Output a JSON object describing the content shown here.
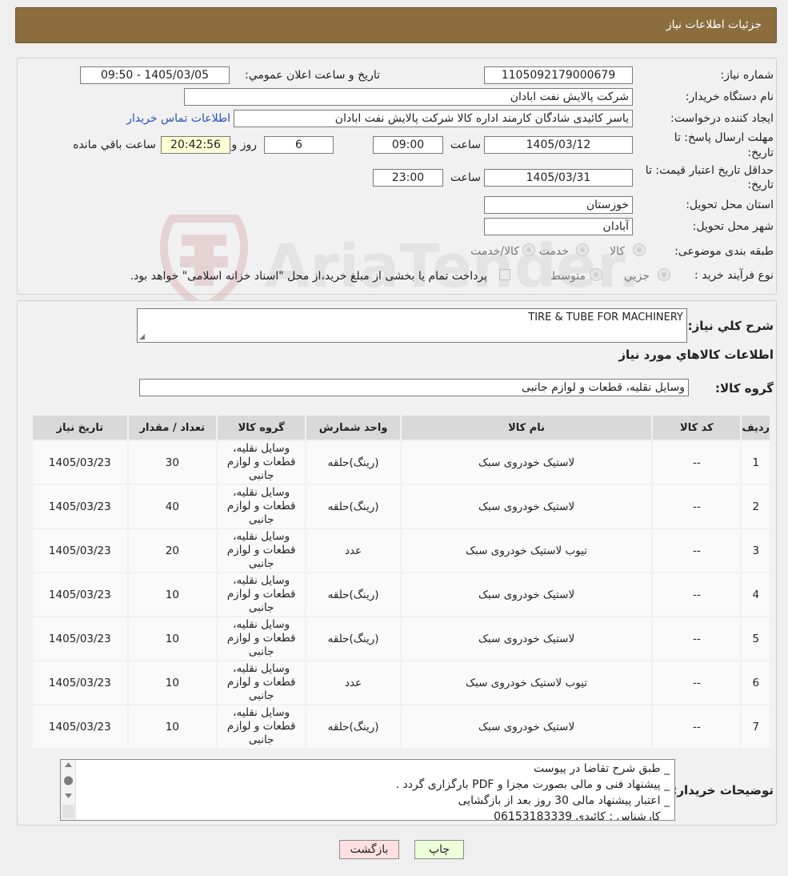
{
  "header": {
    "title": "جزئیات اطلاعات نیاز"
  },
  "form": {
    "need_number_label": "شماره نیاز:",
    "need_number": "1105092179000679",
    "announce_label": "تاريخ و ساعت اعلان عمومي:",
    "announce_value": "1405/03/05 - 09:50",
    "buyer_label": "نام دستگاه خریدار:",
    "buyer_value": "شرکت پالایش نفت ابادان",
    "creator_label": "ایجاد کننده درخواست:",
    "creator_value": "یاسر کائیدی شادگان کارمند اداره کالا شرکت پالایش نفت ابادان",
    "contact_link": "اطلاعات تماس خریدار",
    "deadline_label_1": "مهلت ارسال پاسخ: تا",
    "deadline_label_2": "تاریخ:",
    "deadline_date": "1405/03/12",
    "hour_label": "ساعت",
    "deadline_time": "09:00",
    "days_value": "6",
    "days_label": "روز و",
    "remaining_time": "20:42:56",
    "remaining_label": "ساعت باقي مانده",
    "validity_label_1": "حداقل تاریخ اعتبار قیمت: تا",
    "validity_label_2": "تاریخ:",
    "validity_date": "1405/03/31",
    "validity_time": "23:00",
    "province_label": "استان محل تحویل:",
    "province_value": "خوزستان",
    "city_label": "شهر محل تحویل:",
    "city_value": "آبادان",
    "category_label": "طبقه بندی موضوعی:",
    "category_options": [
      "کالا",
      "خدمت",
      "کالا/خدمت"
    ],
    "process_label": "نوع فرآیند خرید :",
    "process_options": [
      "جزیي",
      "متوسط"
    ],
    "payment_note": "پرداخت تمام يا بخشی از مبلغ خرید،از محل \"اسناد خزانه اسلامی\" خواهد بود."
  },
  "summary": {
    "label": "شرح کلي نياز:",
    "value": "TIRE & TUBE FOR MACHINERY",
    "items_heading": "اطلاعات کالاهاي مورد نياز",
    "group_label": "گروه کالا:",
    "group_value": "وسایل نقلیه، قطعات و لوازم جانبی"
  },
  "table": {
    "headers": [
      "رديف",
      "کد کالا",
      "نام کالا",
      "واحد شمارش",
      "گروه کالا",
      "تعداد / مقدار",
      "تاريخ نياز"
    ],
    "rows": [
      [
        "1",
        "--",
        "لاستیک خودروی سبک",
        "(رینگ)حلقه",
        "وسایل نقلیه، قطعات و لوازم جانبی",
        "30",
        "1405/03/23"
      ],
      [
        "2",
        "--",
        "لاستیک خودروی سبک",
        "(رینگ)حلقه",
        "وسایل نقلیه، قطعات و لوازم جانبی",
        "40",
        "1405/03/23"
      ],
      [
        "3",
        "--",
        "تیوب لاستیک خودروی سبک",
        "عدد",
        "وسایل نقلیه، قطعات و لوازم جانبی",
        "20",
        "1405/03/23"
      ],
      [
        "4",
        "--",
        "لاستیک خودروی سبک",
        "(رینگ)حلقه",
        "وسایل نقلیه، قطعات و لوازم جانبی",
        "10",
        "1405/03/23"
      ],
      [
        "5",
        "--",
        "لاستیک خودروی سبک",
        "(رینگ)حلقه",
        "وسایل نقلیه، قطعات و لوازم جانبی",
        "10",
        "1405/03/23"
      ],
      [
        "6",
        "--",
        "تیوب لاستیک خودروی سبک",
        "عدد",
        "وسایل نقلیه، قطعات و لوازم جانبی",
        "10",
        "1405/03/23"
      ],
      [
        "7",
        "--",
        "لاستیک خودروی سبک",
        "(رینگ)حلقه",
        "وسایل نقلیه، قطعات و لوازم جانبی",
        "10",
        "1405/03/23"
      ]
    ]
  },
  "buyer_notes": {
    "label": "توضیحات خریدار:",
    "lines": [
      "_ طبق شرح تقاضا در پیوست",
      "_ پیشنهاد فنی و مالی بصورت مجزا و PDF  بارگزاری گردد .",
      "_ اعتبار پیشنهاد مالی 30 روز بعد از بازگشایی",
      "_ کارشناس : کائیدی 06153183339"
    ]
  },
  "buttons": {
    "print": "چاپ",
    "back": "بازگشت"
  },
  "watermark": {
    "text": "AriaTender.neT"
  }
}
